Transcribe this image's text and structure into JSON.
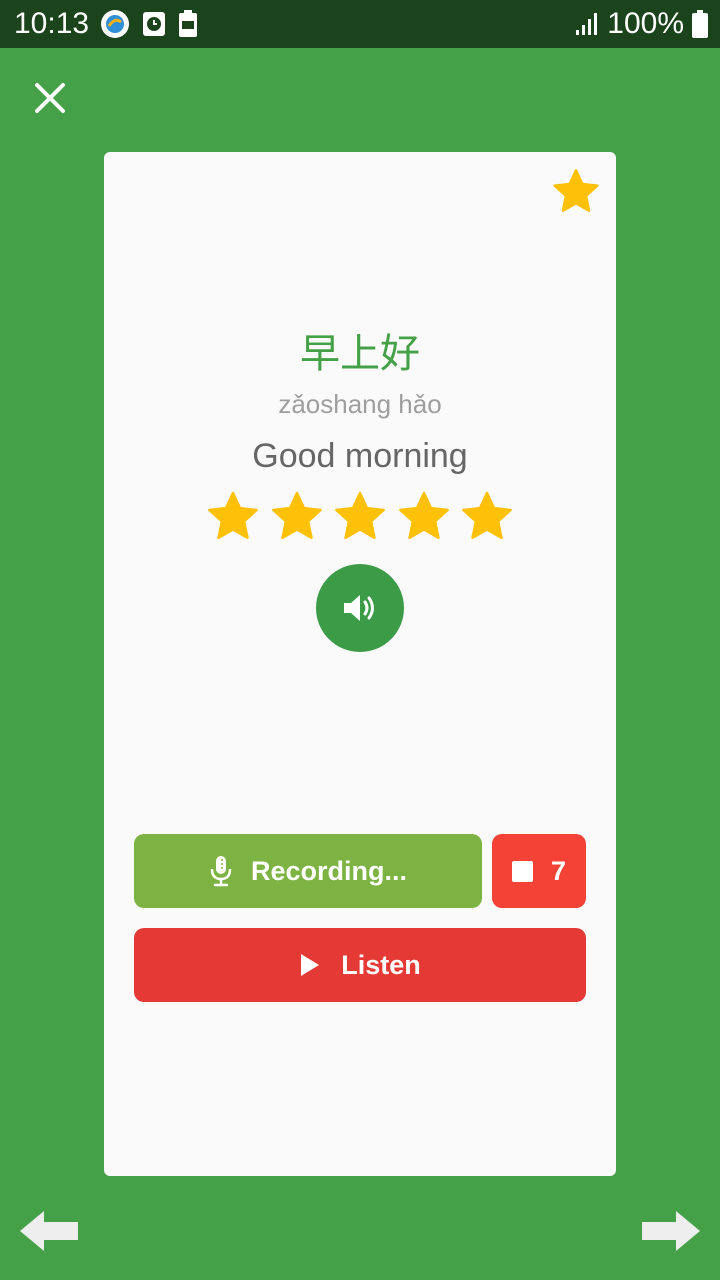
{
  "status_bar": {
    "time": "10:13",
    "battery_percent": "100%",
    "icons": [
      "app-notification-icon",
      "clock-app-icon",
      "battery-saver-icon",
      "signal-icon",
      "battery-icon"
    ]
  },
  "lesson_card": {
    "hanzi": "早上好",
    "pinyin": "zǎoshang hǎo",
    "translation": "Good morning",
    "rating_stars": 5,
    "favorite": true
  },
  "controls": {
    "recording_label": "Recording...",
    "countdown": "7",
    "listen_label": "Listen"
  },
  "colors": {
    "background_green": "#45A147",
    "status_bar": "#1B431C",
    "card": "#FAFAFA",
    "hanzi_green": "#45A147",
    "star_gold": "#FFC107",
    "speaker_green": "#3C9B47",
    "record_green": "#7CB342",
    "stop_red": "#F44336",
    "listen_red": "#E53935"
  }
}
